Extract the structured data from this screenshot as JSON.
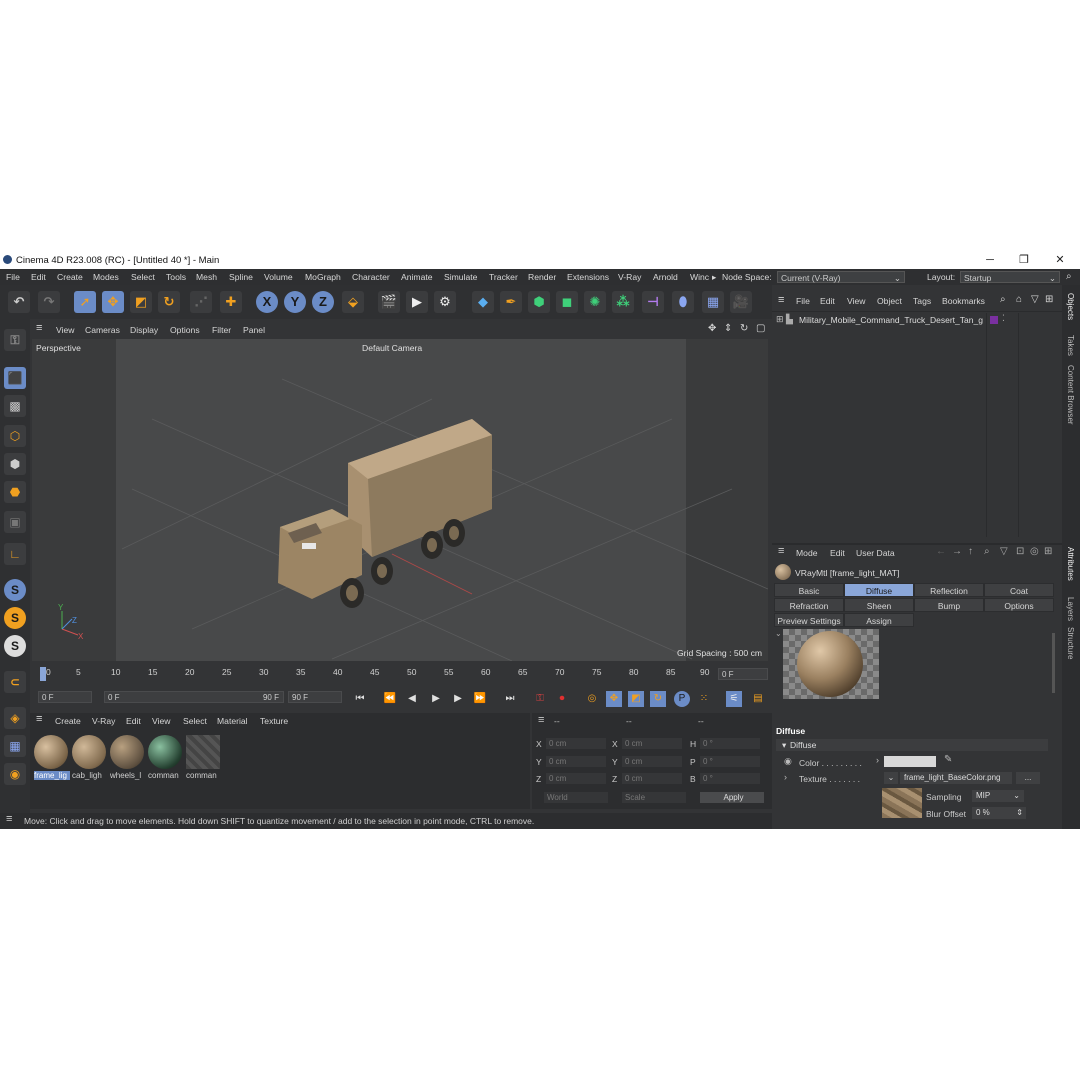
{
  "window": {
    "title": "Cinema 4D R23.008 (RC) - [Untitled 40 *] - Main",
    "minimize": "─",
    "maximize": "❐",
    "close": "✕"
  },
  "menu": {
    "items": [
      "File",
      "Edit",
      "Create",
      "Modes",
      "Select",
      "Tools",
      "Mesh",
      "Spline",
      "Volume",
      "MoGraph",
      "Character",
      "Animate",
      "Simulate",
      "Tracker",
      "Render",
      "Extensions",
      "V-Ray",
      "Arnold",
      "Winc"
    ],
    "node_space_label": "Node Space:",
    "node_space_value": "Current (V-Ray)",
    "layout_label": "Layout:",
    "layout_value": "Startup"
  },
  "viewport": {
    "menu": [
      "View",
      "Cameras",
      "Display",
      "Options",
      "Filter",
      "Panel"
    ],
    "name": "Perspective",
    "camera": "Default Camera",
    "grid_spacing": "Grid Spacing : 500 cm"
  },
  "timeline": {
    "ticks": [
      "0",
      "5",
      "10",
      "15",
      "20",
      "25",
      "30",
      "35",
      "40",
      "45",
      "50",
      "55",
      "60",
      "65",
      "70",
      "75",
      "80",
      "85",
      "90"
    ],
    "current_frame": "0 F",
    "start_frame": "0 F",
    "range_start": "0 F",
    "range_end": "90 F",
    "end_frame": "90 F"
  },
  "material_manager": {
    "menu": [
      "Create",
      "V-Ray",
      "Edit",
      "View",
      "Select",
      "Material",
      "Texture"
    ],
    "materials": [
      {
        "name": "frame_lig"
      },
      {
        "name": "cab_ligh"
      },
      {
        "name": "wheels_l"
      },
      {
        "name": "comman"
      },
      {
        "name": "comman"
      }
    ]
  },
  "coordinates": {
    "header": [
      "--",
      "--",
      "--"
    ],
    "rows": [
      {
        "a_label": "X",
        "a_val": "0 cm",
        "b_label": "X",
        "b_val": "0 cm",
        "c_label": "H",
        "c_val": "0 °"
      },
      {
        "a_label": "Y",
        "a_val": "0 cm",
        "b_label": "Y",
        "b_val": "0 cm",
        "c_label": "P",
        "c_val": "0 °"
      },
      {
        "a_label": "Z",
        "a_val": "0 cm",
        "b_label": "Z",
        "b_val": "0 cm",
        "c_label": "B",
        "c_val": "0 °"
      }
    ],
    "world": "World",
    "scale": "Scale",
    "apply": "Apply"
  },
  "status": "Move: Click and drag to move elements. Hold down SHIFT to quantize movement / add to the selection in point mode, CTRL to remove.",
  "objects": {
    "menu": [
      "File",
      "Edit",
      "View",
      "Object",
      "Tags",
      "Bookmarks"
    ],
    "items": [
      {
        "name": "Military_Mobile_Command_Truck_Desert_Tan_g"
      }
    ]
  },
  "attributes": {
    "menu": [
      "Mode",
      "Edit",
      "User Data"
    ],
    "material_title": "VRayMtl [frame_light_MAT]",
    "tabs_row1": [
      "Basic",
      "Diffuse",
      "Reflection",
      "Coat"
    ],
    "tabs_row2": [
      "Refraction",
      "Sheen",
      "Bump",
      "Options"
    ],
    "tabs_row3": [
      "Preview Settings",
      "Assign"
    ],
    "section": "Diffuse",
    "group": "Diffuse",
    "color_label": "Color . . . . . . . . .",
    "texture_label": "Texture . . . . . . .",
    "texture_file": "frame_light_BaseColor.png",
    "texture_more": "...",
    "sampling_label": "Sampling",
    "sampling_value": "MIP",
    "blur_label": "Blur Offset",
    "blur_value": "0 %"
  },
  "side_tabs": {
    "right_top": [
      "Objects",
      "Takes",
      "Content Browser"
    ],
    "right_bottom": [
      "Attributes",
      "Layers",
      "Structure"
    ]
  },
  "colors": {
    "accent": "#6b8cc7",
    "tab_active": "#8aa6d8",
    "bg": "#333436",
    "panel": "#2c2d2f"
  }
}
